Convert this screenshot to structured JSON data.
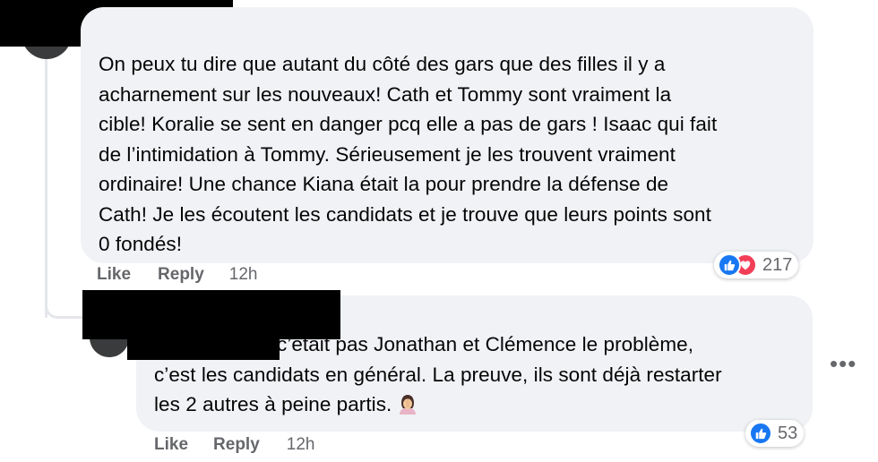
{
  "main_comment": {
    "lines": [
      "On peux tu dire que autant du côté des gars que des filles il y a",
      "acharnement sur les nouveaux! Cath et Tommy sont vraiment la",
      "cible! Koralie se sent en danger pcq elle a pas de gars ! Isaac qui fait",
      "de l’intimidation à Tommy. Sérieusement je les trouvent vraiment",
      "ordinaire! Une chance Kiana était la pour prendre la défense de",
      "Cath! Je les écoutent les candidats et je trouve que leurs points sont",
      "0 fondés!"
    ],
    "like_label": "Like",
    "reply_label": "Reply",
    "time": "12h",
    "reaction_icons": [
      "like-icon",
      "love-icon"
    ],
    "reaction_count": "217"
  },
  "reply_comment": {
    "lines": [
      "c’était pas Jonathan et Clémence le problème,",
      "c’est les candidats en général. La preuve, ils sont déjà restarter",
      "les 2 autres à peine partis."
    ],
    "emoji": "woman-facepalming-emoji",
    "like_label": "Like",
    "reply_label": "Reply",
    "time": "12h",
    "reaction_icons": [
      "like-icon"
    ],
    "reaction_count": "53"
  },
  "more_button": {
    "label": "•••"
  },
  "colors": {
    "bubble_bg": "#f0f2f5",
    "meta_text": "#65676b",
    "like_blue": "#1877f2",
    "love_red": "#f33e58",
    "redaction": "#000000"
  }
}
